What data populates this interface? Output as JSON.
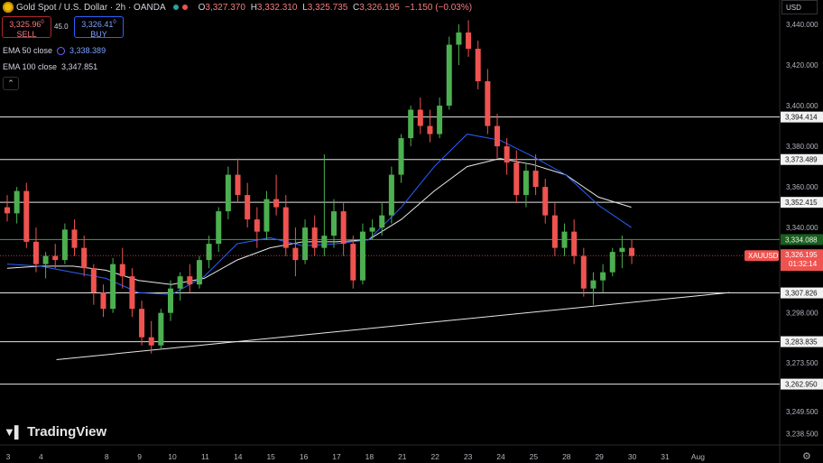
{
  "header": {
    "title": "Gold Spot / U.S. Dollar · 2h · OANDA",
    "ohlc": [
      {
        "k": "O",
        "v": "3,327.370"
      },
      {
        "k": "H",
        "v": "3,332.310"
      },
      {
        "k": "L",
        "v": "3,325.735"
      },
      {
        "k": "C",
        "v": "3,326.195"
      }
    ],
    "change": "−1.150 (−0.03%)"
  },
  "trade": {
    "sell_price": "3,325.96",
    "sell_sup": "0",
    "sell_label": "SELL",
    "spread": "45.0",
    "buy_price": "3,326.41",
    "buy_sup": "0",
    "buy_label": "BUY"
  },
  "indicators": [
    {
      "label": "EMA 50 close",
      "value": "3,338.389",
      "color": "#2962ff"
    },
    {
      "label": "EMA 100 close",
      "value": "3,347.851",
      "color": "#e0e0e0"
    }
  ],
  "brand": "TradingView",
  "currency": "USD",
  "symbol_tag": "XAUUSD",
  "last_price": "3,326.195",
  "countdown": "01:32:14",
  "colors": {
    "up": "#4caf50",
    "down": "#ef5350",
    "ema50": "#2962ff",
    "ema100": "#e8e8e8",
    "level": "#ffffff",
    "green_level": "#4caf50",
    "price_tag": "#ef5350"
  },
  "chart_data": {
    "type": "candlestick",
    "ylim": [
      3233,
      3452
    ],
    "y_ticks": [
      "3,440.000",
      "3,420.000",
      "3,400.000",
      "3,380.000",
      "3,360.000",
      "3,340.000",
      "3,298.000",
      "3,273.500",
      "3,249.500",
      "3,238.500"
    ],
    "x_ticks": [
      {
        "label": "3",
        "i": 0
      },
      {
        "label": "4",
        "i": 4
      },
      {
        "label": "8",
        "i": 12
      },
      {
        "label": "9",
        "i": 16
      },
      {
        "label": "10",
        "i": 20
      },
      {
        "label": "11",
        "i": 24
      },
      {
        "label": "14",
        "i": 28
      },
      {
        "label": "15",
        "i": 32
      },
      {
        "label": "16",
        "i": 36
      },
      {
        "label": "17",
        "i": 40
      },
      {
        "label": "18",
        "i": 44
      },
      {
        "label": "21",
        "i": 48
      },
      {
        "label": "22",
        "i": 52
      },
      {
        "label": "23",
        "i": 56
      },
      {
        "label": "24",
        "i": 60
      },
      {
        "label": "25",
        "i": 64
      },
      {
        "label": "28",
        "i": 68
      },
      {
        "label": "29",
        "i": 72
      },
      {
        "label": "30",
        "i": 76
      },
      {
        "label": "31",
        "i": 80
      },
      {
        "label": "Aug",
        "i": 84
      }
    ],
    "horizontal_levels": [
      {
        "value": 3394.414,
        "label": "3,394.414",
        "style": "white"
      },
      {
        "value": 3373.489,
        "label": "3,373.489",
        "style": "white"
      },
      {
        "value": 3352.415,
        "label": "3,352.415",
        "style": "white"
      },
      {
        "value": 3334.088,
        "label": "3,334.088",
        "style": "green"
      },
      {
        "value": 3307.826,
        "label": "3,307.826",
        "style": "white"
      },
      {
        "value": 3283.835,
        "label": "3,283.835",
        "style": "white"
      },
      {
        "value": 3262.95,
        "label": "3,262.950",
        "style": "white"
      }
    ],
    "last_value": 3326.195,
    "trendline": {
      "from": {
        "i": 6,
        "v": 3275
      },
      "to": {
        "i": 88,
        "v": 3308
      }
    },
    "ema50": [
      [
        0,
        3322
      ],
      [
        4,
        3321
      ],
      [
        8,
        3318
      ],
      [
        12,
        3315
      ],
      [
        16,
        3308
      ],
      [
        20,
        3307
      ],
      [
        24,
        3316
      ],
      [
        28,
        3332
      ],
      [
        32,
        3335
      ],
      [
        36,
        3331
      ],
      [
        40,
        3332
      ],
      [
        44,
        3334
      ],
      [
        48,
        3350
      ],
      [
        52,
        3370
      ],
      [
        56,
        3386
      ],
      [
        60,
        3383
      ],
      [
        64,
        3375
      ],
      [
        68,
        3366
      ],
      [
        72,
        3351
      ],
      [
        76,
        3340
      ]
    ],
    "ema100": [
      [
        0,
        3320
      ],
      [
        4,
        3321
      ],
      [
        8,
        3321
      ],
      [
        12,
        3319
      ],
      [
        16,
        3314
      ],
      [
        20,
        3312
      ],
      [
        24,
        3315
      ],
      [
        28,
        3324
      ],
      [
        32,
        3330
      ],
      [
        36,
        3333
      ],
      [
        40,
        3333
      ],
      [
        44,
        3334
      ],
      [
        48,
        3344
      ],
      [
        52,
        3358
      ],
      [
        56,
        3370
      ],
      [
        60,
        3374
      ],
      [
        64,
        3371
      ],
      [
        68,
        3366
      ],
      [
        72,
        3355
      ],
      [
        76,
        3350
      ]
    ],
    "ohlc_series": [
      [
        3350,
        3356,
        3343,
        3347
      ],
      [
        3347,
        3360,
        3342,
        3358
      ],
      [
        3358,
        3362,
        3330,
        3333
      ],
      [
        3333,
        3340,
        3318,
        3322
      ],
      [
        3322,
        3328,
        3315,
        3326
      ],
      [
        3326,
        3332,
        3320,
        3324
      ],
      [
        3324,
        3342,
        3322,
        3339
      ],
      [
        3339,
        3344,
        3326,
        3330
      ],
      [
        3330,
        3336,
        3316,
        3320
      ],
      [
        3320,
        3322,
        3302,
        3308
      ],
      [
        3308,
        3312,
        3296,
        3300
      ],
      [
        3300,
        3325,
        3298,
        3322
      ],
      [
        3322,
        3330,
        3310,
        3316
      ],
      [
        3316,
        3320,
        3296,
        3300
      ],
      [
        3300,
        3304,
        3282,
        3286
      ],
      [
        3286,
        3294,
        3278,
        3282
      ],
      [
        3282,
        3300,
        3280,
        3298
      ],
      [
        3298,
        3314,
        3294,
        3310
      ],
      [
        3310,
        3318,
        3304,
        3316
      ],
      [
        3316,
        3322,
        3308,
        3312
      ],
      [
        3312,
        3326,
        3310,
        3324
      ],
      [
        3324,
        3336,
        3320,
        3332
      ],
      [
        3332,
        3350,
        3328,
        3348
      ],
      [
        3348,
        3370,
        3344,
        3366
      ],
      [
        3366,
        3374,
        3352,
        3356
      ],
      [
        3356,
        3362,
        3340,
        3344
      ],
      [
        3344,
        3350,
        3330,
        3338
      ],
      [
        3338,
        3358,
        3334,
        3354
      ],
      [
        3354,
        3366,
        3346,
        3350
      ],
      [
        3350,
        3356,
        3326,
        3330
      ],
      [
        3330,
        3340,
        3316,
        3324
      ],
      [
        3324,
        3344,
        3322,
        3340
      ],
      [
        3340,
        3346,
        3326,
        3330
      ],
      [
        3330,
        3376,
        3326,
        3336
      ],
      [
        3336,
        3354,
        3330,
        3348
      ],
      [
        3348,
        3352,
        3326,
        3332
      ],
      [
        3332,
        3336,
        3310,
        3314
      ],
      [
        3314,
        3342,
        3312,
        3338
      ],
      [
        3338,
        3344,
        3334,
        3340
      ],
      [
        3340,
        3352,
        3336,
        3346
      ],
      [
        3346,
        3370,
        3342,
        3366
      ],
      [
        3366,
        3386,
        3362,
        3384
      ],
      [
        3384,
        3400,
        3380,
        3398
      ],
      [
        3398,
        3404,
        3386,
        3390
      ],
      [
        3390,
        3398,
        3382,
        3386
      ],
      [
        3386,
        3404,
        3384,
        3400
      ],
      [
        3400,
        3434,
        3398,
        3430
      ],
      [
        3430,
        3440,
        3420,
        3436
      ],
      [
        3436,
        3442,
        3424,
        3428
      ],
      [
        3428,
        3432,
        3408,
        3412
      ],
      [
        3412,
        3418,
        3386,
        3390
      ],
      [
        3390,
        3396,
        3374,
        3380
      ],
      [
        3380,
        3384,
        3366,
        3372
      ],
      [
        3372,
        3378,
        3352,
        3356
      ],
      [
        3356,
        3372,
        3350,
        3368
      ],
      [
        3368,
        3376,
        3356,
        3360
      ],
      [
        3360,
        3364,
        3342,
        3346
      ],
      [
        3346,
        3352,
        3326,
        3330
      ],
      [
        3330,
        3342,
        3326,
        3338
      ],
      [
        3338,
        3344,
        3322,
        3326
      ],
      [
        3326,
        3330,
        3306,
        3310
      ],
      [
        3310,
        3318,
        3302,
        3314
      ],
      [
        3314,
        3322,
        3308,
        3318
      ],
      [
        3318,
        3330,
        3316,
        3328
      ],
      [
        3328,
        3336,
        3320,
        3330
      ],
      [
        3330,
        3334,
        3322,
        3326
      ]
    ]
  }
}
